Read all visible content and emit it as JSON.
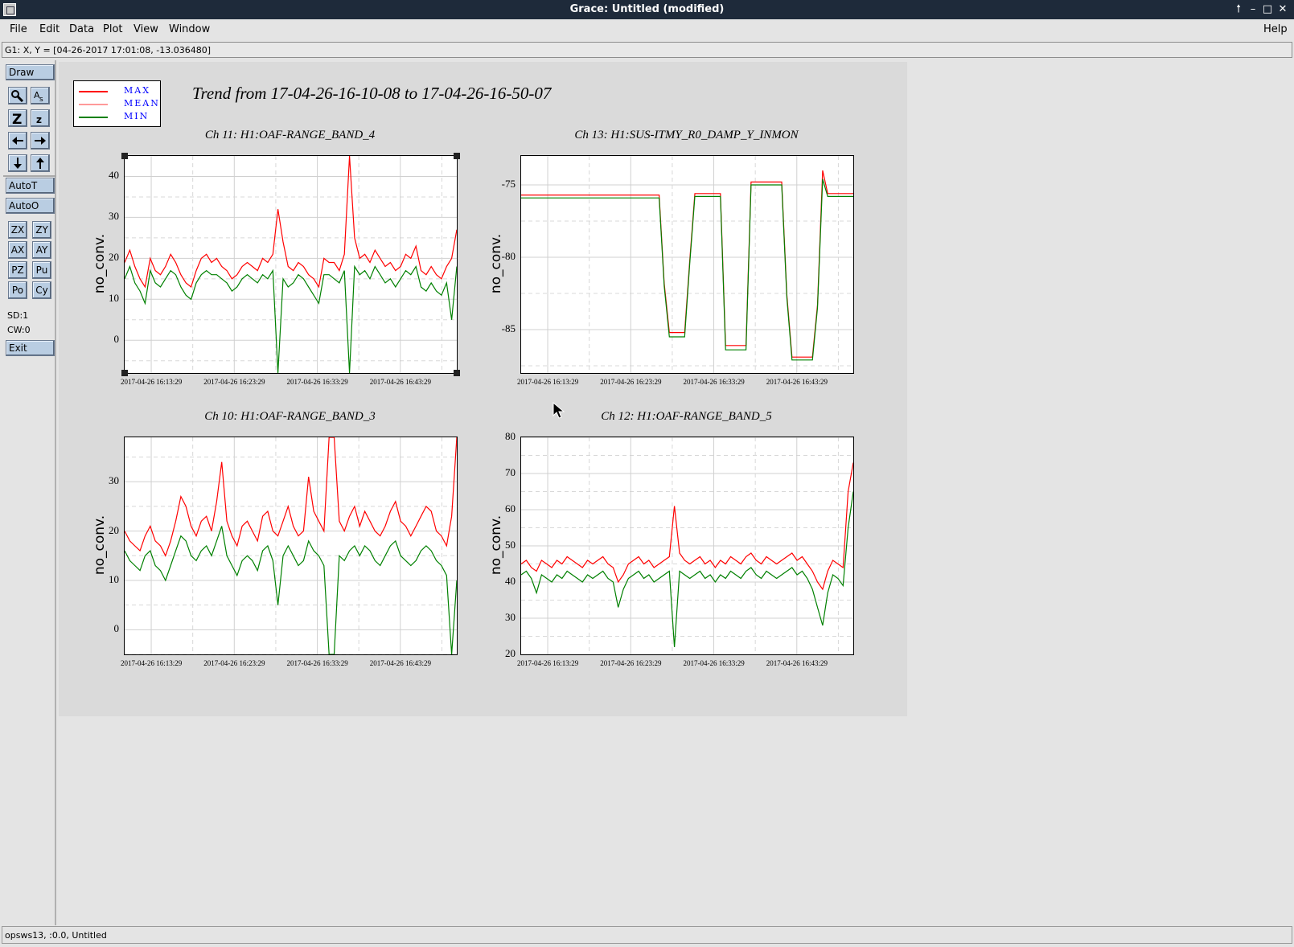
{
  "window": {
    "title": "Grace: Untitled (modified)",
    "controls": {
      "restore": "🠕",
      "minimize": "–",
      "maximize": "□",
      "close": "✕"
    }
  },
  "menu": {
    "items": [
      "File",
      "Edit",
      "Data",
      "Plot",
      "View",
      "Window"
    ],
    "help": "Help"
  },
  "coords": "G1: X, Y = [04-26-2017 17:01:08, -13.036480]",
  "toolbar": {
    "draw": "Draw",
    "autot": "AutoT",
    "autoo": "AutoO",
    "zx": "ZX",
    "zy": "ZY",
    "ax": "AX",
    "ay": "AY",
    "pz": "PZ",
    "pu": "Pu",
    "po": "Po",
    "cy": "Cy",
    "sd": "SD:1",
    "cw": "CW:0",
    "exit": "Exit"
  },
  "legend": [
    {
      "label": "MAX",
      "color": "#ff0000"
    },
    {
      "label": "MEAN",
      "color": "#ff9a9a"
    },
    {
      "label": "MIN",
      "color": "#008000"
    }
  ],
  "main_title": "Trend from 17-04-26-16-10-08 to 17-04-26-16-50-07",
  "status": "opsws13, :0.0, Untitled",
  "chart_data": [
    {
      "type": "line",
      "title": "Ch 11: H1:OAF-RANGE_BAND_4",
      "ylabel": "no_conv.",
      "ylim": [
        -8,
        45
      ],
      "yticks": [
        0,
        10,
        20,
        30,
        40
      ],
      "x_ticks": [
        "2017-04-26 16:13:29",
        "2017-04-26 16:23:29",
        "2017-04-26 16:33:29",
        "2017-04-26 16:43:29"
      ],
      "grid": true,
      "series": [
        {
          "name": "MAX",
          "color": "#ff0000",
          "values": [
            19,
            22,
            18,
            15,
            13,
            20,
            17,
            16,
            18,
            21,
            19,
            16,
            14,
            13,
            17,
            20,
            21,
            19,
            20,
            18,
            17,
            15,
            16,
            18,
            19,
            18,
            17,
            20,
            19,
            21,
            32,
            24,
            18,
            17,
            19,
            18,
            16,
            15,
            13,
            20,
            19,
            19,
            17,
            21,
            45,
            25,
            20,
            21,
            19,
            22,
            20,
            18,
            19,
            17,
            18,
            21,
            20,
            23,
            17,
            16,
            18,
            16,
            15,
            18,
            20,
            27
          ]
        },
        {
          "name": "MIN",
          "color": "#008000",
          "values": [
            15,
            18,
            14,
            12,
            9,
            17,
            14,
            13,
            15,
            17,
            16,
            13,
            11,
            10,
            14,
            16,
            17,
            16,
            16,
            15,
            14,
            12,
            13,
            15,
            16,
            15,
            14,
            16,
            15,
            17,
            -8,
            15,
            13,
            14,
            16,
            15,
            13,
            11,
            9,
            16,
            16,
            15,
            14,
            17,
            -8,
            18,
            16,
            17,
            15,
            18,
            16,
            14,
            15,
            13,
            15,
            17,
            16,
            18,
            13,
            12,
            14,
            12,
            11,
            14,
            5,
            18
          ]
        }
      ]
    },
    {
      "type": "line",
      "title": "Ch 13: H1:SUS-ITMY_R0_DAMP_Y_INMON",
      "ylabel": "no_conv.",
      "ylim": [
        -88,
        -73
      ],
      "yticks": [
        -75,
        -80,
        -85
      ],
      "x_ticks": [
        "2017-04-26 16:13:29",
        "2017-04-26 16:23:29",
        "2017-04-26 16:33:29",
        "2017-04-26 16:43:29"
      ],
      "grid": true,
      "series": [
        {
          "name": "MAX",
          "color": "#ff0000",
          "values": [
            -75.7,
            -75.7,
            -75.7,
            -75.7,
            -75.7,
            -75.7,
            -75.7,
            -75.7,
            -75.7,
            -75.7,
            -75.7,
            -75.7,
            -75.7,
            -75.7,
            -75.7,
            -75.7,
            -75.7,
            -75.7,
            -75.7,
            -75.7,
            -75.7,
            -75.7,
            -75.7,
            -75.7,
            -75.7,
            -75.7,
            -75.7,
            -75.7,
            -81.8,
            -85.2,
            -85.2,
            -85.2,
            -85.2,
            -80.2,
            -75.6,
            -75.6,
            -75.6,
            -75.6,
            -75.6,
            -75.6,
            -86.1,
            -86.1,
            -86.1,
            -86.1,
            -86.1,
            -74.8,
            -74.8,
            -74.8,
            -74.8,
            -74.8,
            -74.8,
            -74.8,
            -82.6,
            -86.9,
            -86.9,
            -86.9,
            -86.9,
            -86.9,
            -83.3,
            -74.0,
            -75.6,
            -75.6,
            -75.6,
            -75.6,
            -75.6,
            -75.6
          ]
        },
        {
          "name": "MIN",
          "color": "#008000",
          "values": [
            -75.9,
            -75.9,
            -75.9,
            -75.9,
            -75.9,
            -75.9,
            -75.9,
            -75.9,
            -75.9,
            -75.9,
            -75.9,
            -75.9,
            -75.9,
            -75.9,
            -75.9,
            -75.9,
            -75.9,
            -75.9,
            -75.9,
            -75.9,
            -75.9,
            -75.9,
            -75.9,
            -75.9,
            -75.9,
            -75.9,
            -75.9,
            -75.9,
            -82.0,
            -85.5,
            -85.5,
            -85.5,
            -85.5,
            -80.4,
            -75.8,
            -75.8,
            -75.8,
            -75.8,
            -75.8,
            -75.8,
            -86.4,
            -86.4,
            -86.4,
            -86.4,
            -86.4,
            -75.0,
            -75.0,
            -75.0,
            -75.0,
            -75.0,
            -75.0,
            -75.0,
            -82.8,
            -87.1,
            -87.1,
            -87.1,
            -87.1,
            -87.1,
            -83.5,
            -74.6,
            -75.8,
            -75.8,
            -75.8,
            -75.8,
            -75.8,
            -75.8
          ]
        }
      ]
    },
    {
      "type": "line",
      "title": "Ch 10: H1:OAF-RANGE_BAND_3",
      "ylabel": "no_conv.",
      "ylim": [
        -5,
        39
      ],
      "yticks": [
        0,
        10,
        20,
        30
      ],
      "x_ticks": [
        "2017-04-26 16:13:29",
        "2017-04-26 16:23:29",
        "2017-04-26 16:33:29",
        "2017-04-26 16:43:29"
      ],
      "grid": true,
      "series": [
        {
          "name": "MAX",
          "color": "#ff0000",
          "values": [
            20,
            18,
            17,
            16,
            19,
            21,
            18,
            17,
            15,
            18,
            22,
            27,
            25,
            21,
            19,
            22,
            23,
            20,
            26,
            34,
            22,
            19,
            17,
            21,
            22,
            20,
            18,
            23,
            24,
            20,
            19,
            22,
            25,
            21,
            19,
            20,
            31,
            24,
            22,
            20,
            39,
            39,
            22,
            20,
            23,
            25,
            21,
            24,
            22,
            20,
            19,
            21,
            24,
            26,
            22,
            21,
            19,
            21,
            23,
            25,
            24,
            20,
            19,
            17,
            23,
            39
          ]
        },
        {
          "name": "MIN",
          "color": "#008000",
          "values": [
            16,
            14,
            13,
            12,
            15,
            16,
            13,
            12,
            10,
            13,
            16,
            19,
            18,
            15,
            14,
            16,
            17,
            15,
            18,
            21,
            15,
            13,
            11,
            14,
            15,
            14,
            12,
            16,
            17,
            14,
            5,
            15,
            17,
            15,
            13,
            14,
            18,
            16,
            15,
            13,
            -5,
            -5,
            15,
            14,
            16,
            17,
            15,
            17,
            16,
            14,
            13,
            15,
            17,
            18,
            15,
            14,
            13,
            14,
            16,
            17,
            16,
            14,
            13,
            11,
            -5,
            10
          ]
        }
      ]
    },
    {
      "type": "line",
      "title": "Ch 12: H1:OAF-RANGE_BAND_5",
      "ylabel": "no_conv.",
      "ylim": [
        20,
        80
      ],
      "yticks": [
        20,
        30,
        40,
        50,
        60,
        70,
        80
      ],
      "x_ticks": [
        "2017-04-26 16:13:29",
        "2017-04-26 16:23:29",
        "2017-04-26 16:33:29",
        "2017-04-26 16:43:29"
      ],
      "grid": true,
      "series": [
        {
          "name": "MAX",
          "color": "#ff0000",
          "values": [
            45,
            46,
            44,
            43,
            46,
            45,
            44,
            46,
            45,
            47,
            46,
            45,
            44,
            46,
            45,
            46,
            47,
            45,
            44,
            40,
            42,
            45,
            46,
            47,
            45,
            46,
            44,
            45,
            46,
            47,
            61,
            48,
            46,
            45,
            46,
            47,
            45,
            46,
            44,
            46,
            45,
            47,
            46,
            45,
            47,
            48,
            46,
            45,
            47,
            46,
            45,
            46,
            47,
            48,
            46,
            47,
            45,
            43,
            40,
            38,
            43,
            46,
            45,
            44,
            65,
            73
          ]
        },
        {
          "name": "MIN",
          "color": "#008000",
          "values": [
            42,
            43,
            41,
            37,
            42,
            41,
            40,
            42,
            41,
            43,
            42,
            41,
            40,
            42,
            41,
            42,
            43,
            41,
            40,
            33,
            38,
            41,
            42,
            43,
            41,
            42,
            40,
            41,
            42,
            43,
            22,
            43,
            42,
            41,
            42,
            43,
            41,
            42,
            40,
            42,
            41,
            43,
            42,
            41,
            43,
            44,
            42,
            41,
            43,
            42,
            41,
            42,
            43,
            44,
            42,
            43,
            41,
            38,
            33,
            28,
            37,
            42,
            41,
            39,
            55,
            65
          ]
        }
      ]
    }
  ]
}
